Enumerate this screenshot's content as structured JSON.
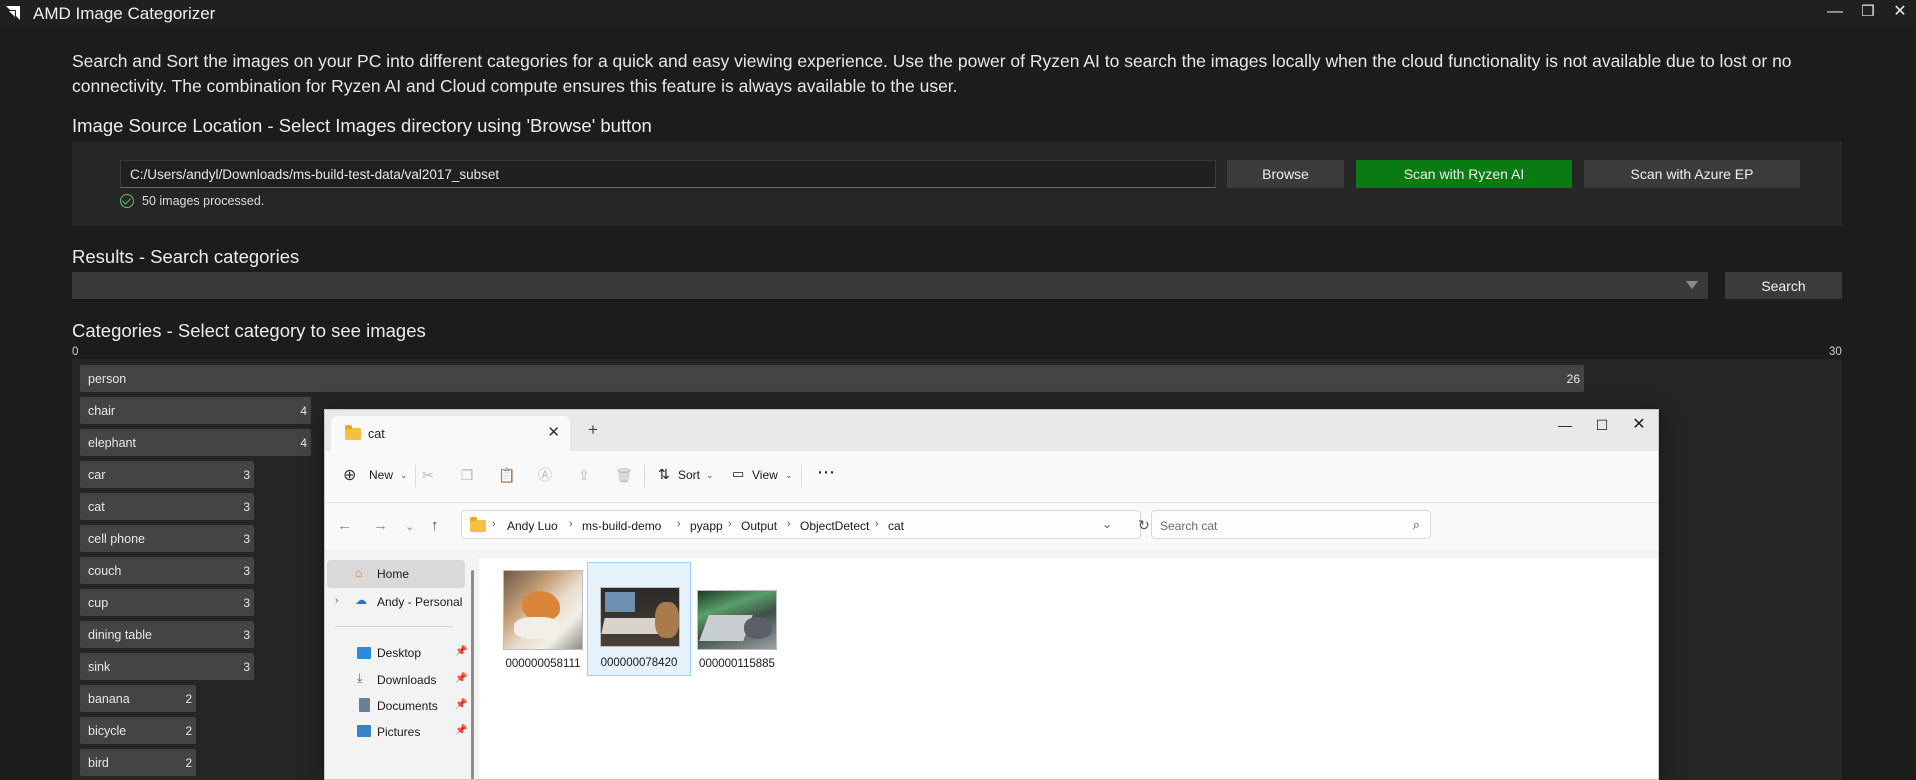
{
  "app": {
    "title": "AMD Image Categorizer",
    "controls": [
      "—",
      "❒",
      "✕"
    ]
  },
  "intro": "Search and Sort the images on your PC into different categories for a quick and easy viewing experience. Use the power of Ryzen AI to search the images locally when the cloud functionality is not available due to lost or no connectivity. The combination for Ryzen AI and Cloud compute ensures this feature is always available to the user.",
  "source": {
    "title": "Image Source Location - Select Images directory using 'Browse' button",
    "path": "C:/Users/andyl/Downloads/ms-build-test-data/val2017_subset",
    "browse_label": "Browse",
    "scan_ryzen_label": "Scan with Ryzen AI",
    "scan_azure_label": "Scan with Azure EP",
    "status": "50 images processed.",
    "scan_ryzen_color": "#0a7a12"
  },
  "results": {
    "title": "Results - Search categories",
    "search_label": "Search"
  },
  "categories": {
    "title": "Categories - Select category to see images",
    "axis_min": "0",
    "axis_max": "30",
    "items": [
      {
        "label": "person",
        "count": "26"
      },
      {
        "label": "chair",
        "count": "4"
      },
      {
        "label": "elephant",
        "count": "4"
      },
      {
        "label": "car",
        "count": "3"
      },
      {
        "label": "cat",
        "count": "3"
      },
      {
        "label": "cell phone",
        "count": "3"
      },
      {
        "label": "couch",
        "count": "3"
      },
      {
        "label": "cup",
        "count": "3"
      },
      {
        "label": "dining table",
        "count": "3"
      },
      {
        "label": "sink",
        "count": "3"
      },
      {
        "label": "banana",
        "count": "2"
      },
      {
        "label": "bicycle",
        "count": "2"
      },
      {
        "label": "bird",
        "count": "2"
      }
    ]
  },
  "explorer": {
    "tab_title": "cat",
    "new_tab": "+",
    "toolbar": {
      "new_label": "New",
      "sort_label": "Sort",
      "view_label": "View",
      "more": "⋯"
    },
    "breadcrumb": [
      "Andy Luo",
      "ms-build-demo",
      "pyapp",
      "Output",
      "ObjectDetect",
      "cat"
    ],
    "search_placeholder": "Search cat",
    "nav": {
      "home": "Home",
      "onedrive": "Andy - Personal",
      "desktop": "Desktop",
      "downloads": "Downloads",
      "documents": "Documents",
      "pictures": "Pictures"
    },
    "files": [
      "000000058111",
      "000000078420",
      "000000115885"
    ]
  }
}
